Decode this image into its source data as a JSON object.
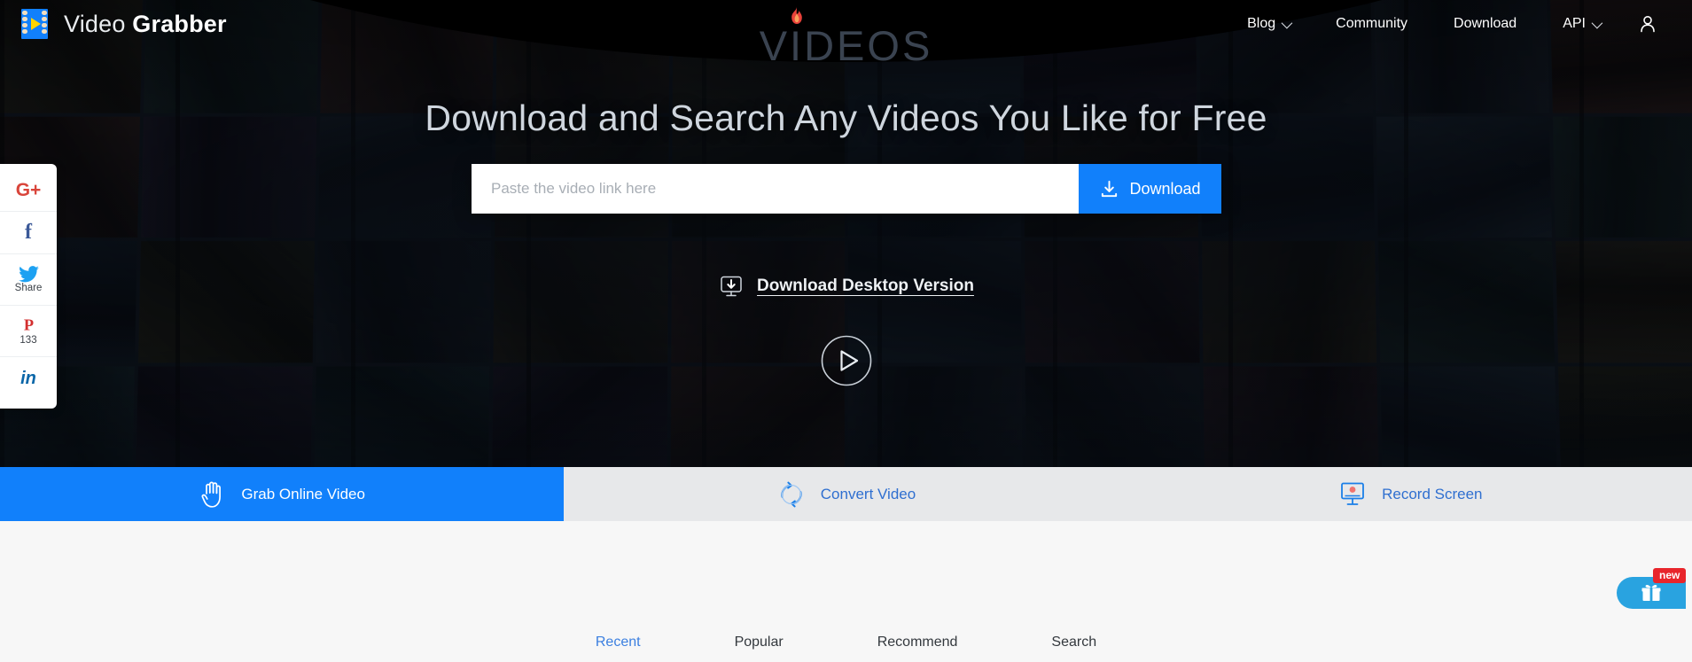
{
  "brand": {
    "name_light": "Video",
    "name_bold": "Grabber",
    "logo_icon": "film-strip-play-icon"
  },
  "nav": {
    "items": [
      {
        "label": "Blog",
        "has_chevron": true
      },
      {
        "label": "Community",
        "has_chevron": false
      },
      {
        "label": "Download",
        "has_chevron": false
      },
      {
        "label": "API",
        "has_chevron": true
      }
    ],
    "account_icon": "user-person-icon"
  },
  "hero": {
    "title": "Download and Search Any Videos You Like for Free",
    "search": {
      "placeholder": "Paste the video link here",
      "value": ""
    },
    "download_button": {
      "label": "Download",
      "icon": "download-tray-icon",
      "color": "#1180fb"
    },
    "desktop_link": {
      "label": "Download Desktop Version",
      "icon": "monitor-download-icon"
    },
    "play_button_icon": "play-circle-icon"
  },
  "social": {
    "items": [
      {
        "name": "google-plus",
        "glyph": "G+",
        "label": "",
        "color": "#d9453b"
      },
      {
        "name": "facebook",
        "glyph": "f",
        "label": "",
        "color": "#3b5998"
      },
      {
        "name": "twitter",
        "glyph": "",
        "label": "Share",
        "color": "#1da1f2"
      },
      {
        "name": "pinterest",
        "glyph": "",
        "label": "133",
        "color": "#d32f2f"
      },
      {
        "name": "linkedin",
        "glyph": "in",
        "label": "",
        "color": "#0a66a8"
      }
    ]
  },
  "tabs": [
    {
      "label": "Grab Online Video",
      "icon": "hand-grab-icon",
      "active": true
    },
    {
      "label": "Convert Video",
      "icon": "circular-arrows-convert-icon",
      "active": false
    },
    {
      "label": "Record Screen",
      "icon": "monitor-record-icon",
      "active": false
    }
  ],
  "videos_section": {
    "logo_text": "VIDEOS",
    "logo_flame_icon": "flame-icon",
    "subtabs": [
      {
        "label": "Recent",
        "active": true
      },
      {
        "label": "Popular",
        "active": false
      },
      {
        "label": "Recommend",
        "active": false
      },
      {
        "label": "Search",
        "active": false
      }
    ]
  },
  "gift_widget": {
    "icon": "gift-box-icon",
    "badge": "new",
    "color": "#29a3e0",
    "badge_color": "#e8252b"
  },
  "colors": {
    "accent_blue": "#1180fb",
    "tab_bar_bg": "#e7e8ea",
    "content_bg": "#f7f7f7",
    "hero_bg": "#0c1118"
  }
}
